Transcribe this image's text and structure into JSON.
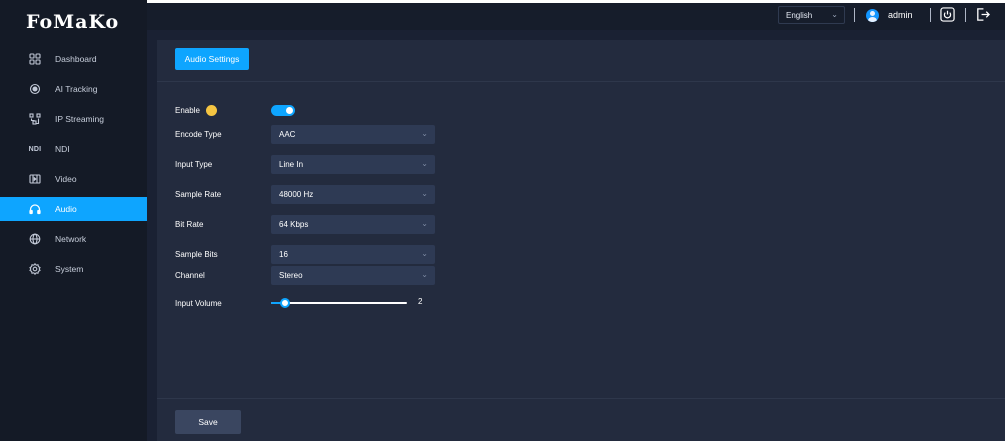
{
  "app": {
    "logo_text": "FoMaKo"
  },
  "sidebar": {
    "items": [
      {
        "label": "Dashboard",
        "icon": "dashboard-grid-icon",
        "active": false
      },
      {
        "label": "AI Tracking",
        "icon": "target-icon",
        "active": false
      },
      {
        "label": "IP Streaming",
        "icon": "streaming-icon",
        "active": false
      },
      {
        "label": "NDI",
        "icon": "ndi-icon",
        "icon_text": "NDI",
        "active": false
      },
      {
        "label": "Video",
        "icon": "video-icon",
        "active": false
      },
      {
        "label": "Audio",
        "icon": "audio-icon",
        "active": true
      },
      {
        "label": "Network",
        "icon": "globe-icon",
        "active": false
      },
      {
        "label": "System",
        "icon": "gear-icon",
        "active": false
      }
    ]
  },
  "header": {
    "language": "English",
    "username": "admin"
  },
  "main": {
    "tab_label": "Audio Settings",
    "form": {
      "enable": {
        "label": "Enable",
        "value": true
      },
      "encode_type": {
        "label": "Encode Type",
        "value": "AAC"
      },
      "input_type": {
        "label": "Input Type",
        "value": "Line In"
      },
      "sample_rate": {
        "label": "Sample Rate",
        "value": "48000 Hz"
      },
      "bit_rate": {
        "label": "Bit Rate",
        "value": "64 Kbps"
      },
      "sample_bits": {
        "label": "Sample Bits",
        "value": "16"
      },
      "channel": {
        "label": "Channel",
        "value": "Stereo"
      },
      "input_volume": {
        "label": "Input Volume",
        "value": "2",
        "fraction": 0.1
      }
    },
    "save_label": "Save"
  },
  "colors": {
    "accent": "#0ea5ff",
    "sidebar_bg": "#141a26",
    "panel_bg": "#232b3e",
    "info": "#f5c542"
  }
}
